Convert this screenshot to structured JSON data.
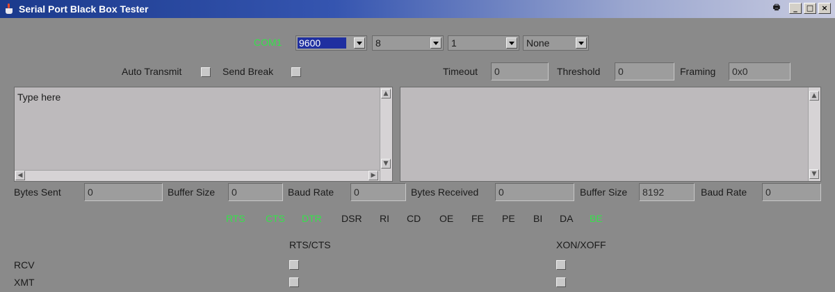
{
  "window": {
    "title": "Serial Port Black Box Tester"
  },
  "port": {
    "name": "COM1",
    "baud": "9600",
    "databits": "8",
    "stopbits": "1",
    "parity": "None"
  },
  "options": {
    "auto_transmit": "Auto Transmit",
    "send_break": "Send Break"
  },
  "line_status": {
    "timeout_label": "Timeout",
    "timeout_value": "0",
    "threshold_label": "Threshold",
    "threshold_value": "0",
    "framing_label": "Framing",
    "framing_value": "0x0"
  },
  "transmit": {
    "text": "Type here",
    "bytes_sent_label": "Bytes Sent",
    "bytes_sent": "0",
    "buffer_size_label": "Buffer Size",
    "buffer_size": "0",
    "baud_rate_label": "Baud Rate",
    "baud_rate": "0"
  },
  "receive": {
    "text": "",
    "bytes_received_label": "Bytes Received",
    "bytes_received": "0",
    "buffer_size_label": "Buffer Size",
    "buffer_size": "8192",
    "baud_rate_label": "Baud Rate",
    "baud_rate": "0"
  },
  "signals": [
    {
      "label": "RTS",
      "active": true
    },
    {
      "label": "CTS",
      "active": true
    },
    {
      "label": "DTR",
      "active": true
    },
    {
      "label": "DSR",
      "active": false
    },
    {
      "label": "RI",
      "active": false
    },
    {
      "label": "CD",
      "active": false
    },
    {
      "label": "OE",
      "active": false
    },
    {
      "label": "FE",
      "active": false
    },
    {
      "label": "PE",
      "active": false
    },
    {
      "label": "BI",
      "active": false
    },
    {
      "label": "DA",
      "active": false
    },
    {
      "label": "BE",
      "active": true
    }
  ],
  "flow_control": {
    "rts_cts": "RTS/CTS",
    "xon_xoff": "XON/XOFF",
    "rcv": "RCV",
    "xmt": "XMT"
  },
  "colors": {
    "active_signal": "#35e24a",
    "title_bar": "#1b3a8c",
    "selection": "#1f2fa0"
  }
}
